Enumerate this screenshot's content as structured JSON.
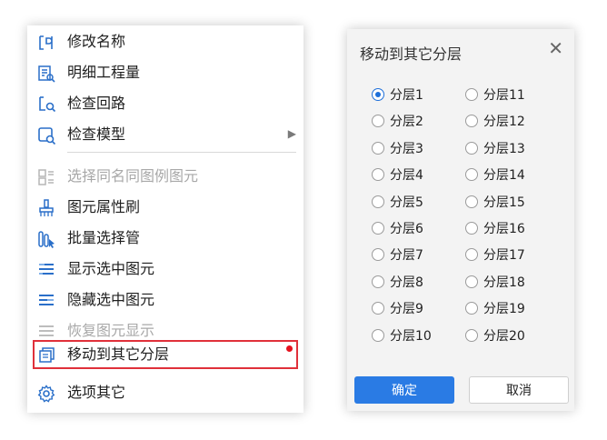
{
  "menu": {
    "items": [
      {
        "label": "修改名称",
        "icon": "rename-icon"
      },
      {
        "label": "明细工程量",
        "icon": "quantity-detail-icon"
      },
      {
        "label": "检查回路",
        "icon": "check-circuit-icon"
      },
      {
        "label": "检查模型",
        "icon": "check-model-icon",
        "submenu_indicator": "▶"
      },
      {
        "label": "选择同名同图例图元",
        "icon": "select-same-legend-icon"
      },
      {
        "label": "图元属性刷",
        "icon": "property-brush-icon"
      },
      {
        "label": "批量选择管",
        "icon": "batch-select-pipe-icon"
      },
      {
        "label": "显示选中图元",
        "icon": "show-selected-icon"
      },
      {
        "label": "隐藏选中图元",
        "icon": "hide-selected-icon"
      },
      {
        "label": "恢复图元显示",
        "icon": "restore-display-icon"
      },
      {
        "label": "移动到其它分层",
        "icon": "move-layer-icon"
      },
      {
        "label": "选项其它",
        "icon": "gear-icon"
      }
    ]
  },
  "dialog": {
    "title": "移动到其它分层",
    "close": "✕",
    "selected": "分层1",
    "layers_left": [
      "分层1",
      "分层2",
      "分层3",
      "分层4",
      "分层5",
      "分层6",
      "分层7",
      "分层8",
      "分层9",
      "分层10"
    ],
    "layers_right": [
      "分层11",
      "分层12",
      "分层13",
      "分层14",
      "分层15",
      "分层16",
      "分层17",
      "分层18",
      "分层19",
      "分层20"
    ],
    "ok_label": "确定",
    "cancel_label": "取消"
  },
  "colors": {
    "accent": "#2a7be4",
    "highlight_border": "#e0303a",
    "disabled_text": "#a8a8a8"
  }
}
